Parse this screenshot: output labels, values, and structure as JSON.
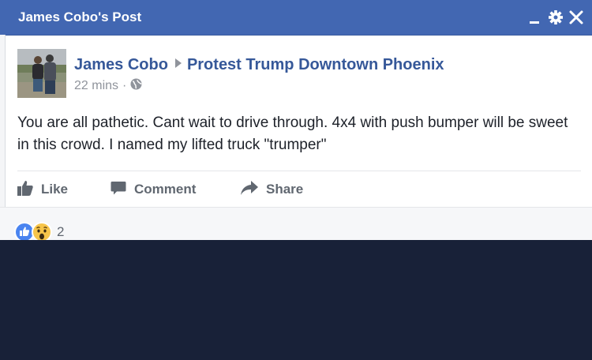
{
  "window": {
    "title": "James Cobo's Post"
  },
  "post": {
    "author": "James Cobo",
    "group": "Protest Trump Downtown Phoenix",
    "time": "22 mins",
    "separator": "·",
    "privacy_icon": "globe-icon",
    "text": "You are all pathetic. Cant wait to drive through. 4x4 with push bumper will be sweet in this crowd. I named my lifted truck \"trumper\""
  },
  "actions": {
    "like": "Like",
    "comment": "Comment",
    "share": "Share"
  },
  "reactions": {
    "icons": [
      "like-icon",
      "wow-icon"
    ],
    "count": "2"
  },
  "colors": {
    "titlebar": "#4267b2",
    "link": "#365899",
    "text": "#1d2129",
    "muted": "#90949c",
    "background": "#182138"
  }
}
